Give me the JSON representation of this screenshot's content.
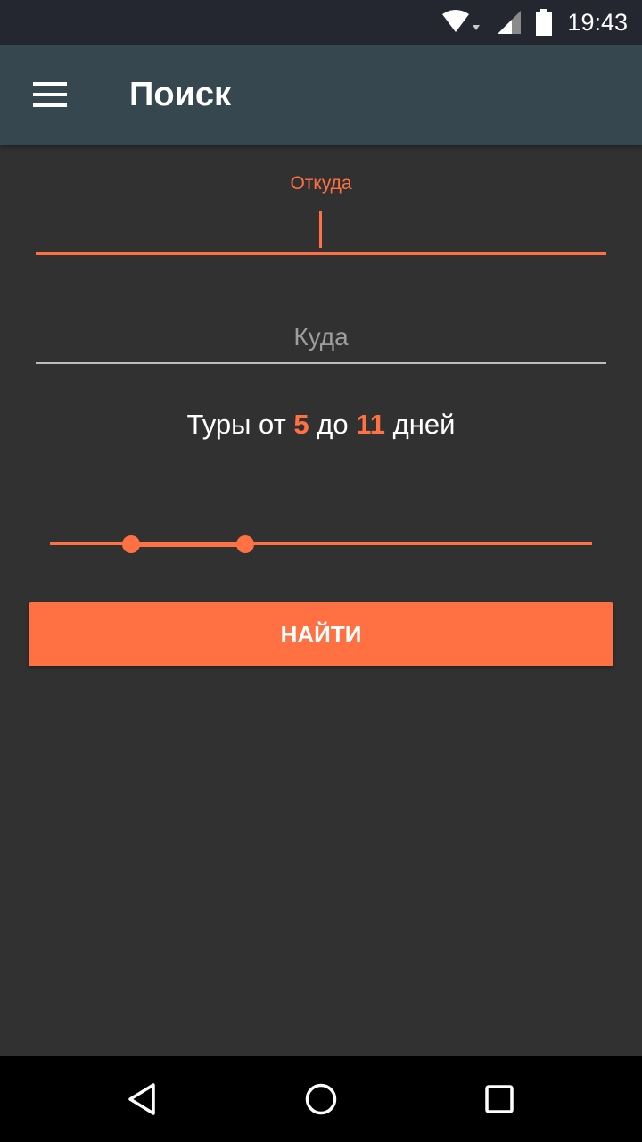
{
  "status_bar": {
    "time": "19:43",
    "icons": [
      "wifi-icon",
      "cell-signal-icon",
      "battery-icon"
    ]
  },
  "toolbar": {
    "title": "Поиск",
    "menu_icon": "hamburger-menu-icon"
  },
  "form": {
    "from": {
      "label": "Откуда",
      "value": ""
    },
    "to": {
      "placeholder": "Куда",
      "value": ""
    },
    "range_text": {
      "prefix": "Туры от",
      "min_days": "5",
      "middle": "до",
      "max_days": "11",
      "suffix": "дней"
    },
    "slider": {
      "low_fraction": 0.15,
      "high_fraction": 0.36
    },
    "search_button": "НАЙТИ"
  },
  "navigation": {
    "icons": [
      "back-icon",
      "home-icon",
      "recents-icon"
    ]
  },
  "colors": {
    "accent": "#ff7043",
    "toolbar": "#37474f",
    "status_bar": "#242630",
    "background": "#313131"
  }
}
